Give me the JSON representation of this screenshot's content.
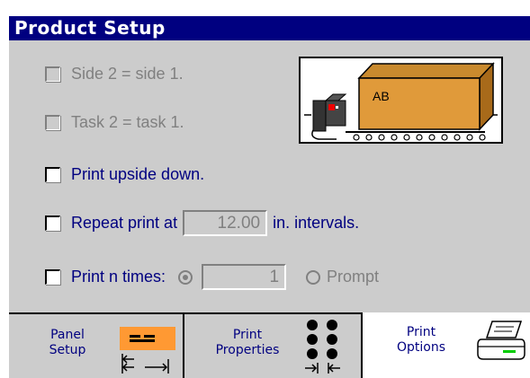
{
  "title": "Product Setup",
  "options": {
    "side2": "Side 2 = side 1.",
    "task2": "Task 2 = task 1.",
    "upside_down": "Print upside down.",
    "repeat_prefix": "Repeat print at",
    "repeat_value": "12.00",
    "repeat_suffix": "in. intervals.",
    "print_n": "Print n times:",
    "n_value": "1",
    "prompt": "Prompt"
  },
  "illustration": {
    "box_label": "AB"
  },
  "tabs": [
    {
      "line1": "Panel",
      "line2": "Setup"
    },
    {
      "line1": "Print",
      "line2": "Properties"
    },
    {
      "line1": "Print",
      "line2": "Options"
    }
  ],
  "colors": {
    "title_bg": "#000080",
    "panel_bg": "#cccccc",
    "label": "#000080",
    "accent": "#ff9933"
  }
}
